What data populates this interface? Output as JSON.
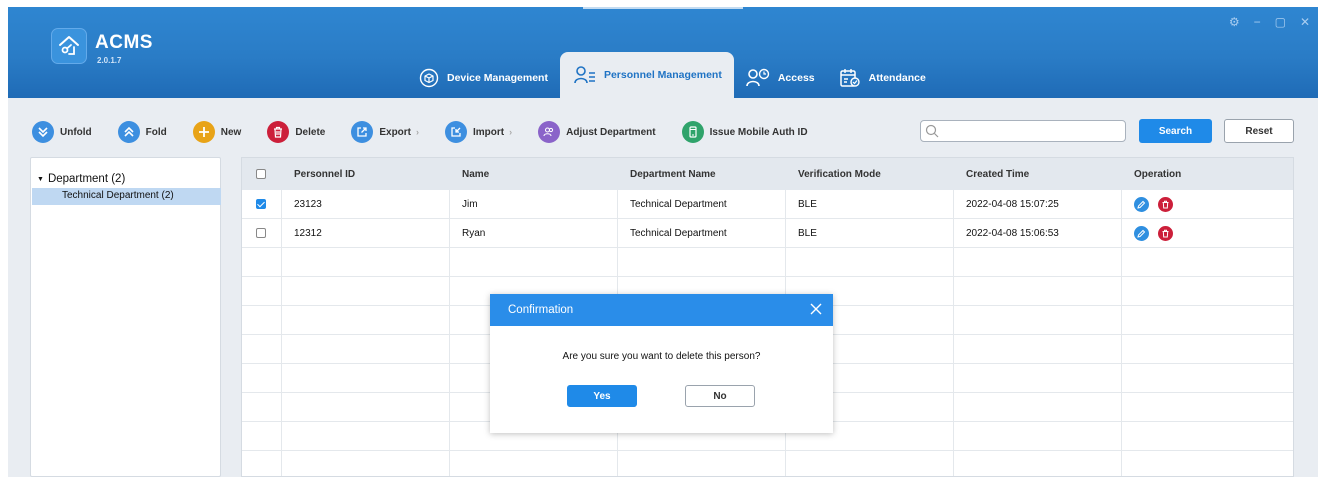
{
  "app": {
    "name": "ACMS",
    "version": "2.0.1.7",
    "colors": {
      "header": "#2a7cc6",
      "accent": "#1f8ae8",
      "danger": "#cc1f3a",
      "selection": "#bfd8f2"
    }
  },
  "window_controls": [
    "⚙",
    "−",
    "▢",
    "✕"
  ],
  "nav": {
    "tabs": [
      {
        "label": "Device Management",
        "icon": "device-box-icon",
        "active": false
      },
      {
        "label": "Personnel Management",
        "icon": "personnel-list-icon",
        "active": true
      },
      {
        "label": "Access",
        "icon": "access-person-clock-icon",
        "active": false
      },
      {
        "label": "Attendance",
        "icon": "calendar-check-icon",
        "active": false
      }
    ]
  },
  "toolbar": {
    "unfold": "Unfold",
    "fold": "Fold",
    "new": "New",
    "delete": "Delete",
    "export": "Export",
    "import": "Import",
    "adjust_department": "Adjust Department",
    "issue_mobile_auth": "Issue Mobile Auth ID"
  },
  "search": {
    "placeholder": "",
    "value": "",
    "search_label": "Search",
    "reset_label": "Reset"
  },
  "tree": {
    "root": "Department (2)",
    "children": [
      "Technical Department (2)"
    ]
  },
  "table": {
    "columns": [
      "Personnel ID",
      "Name",
      "Department Name",
      "Verification Mode",
      "Created Time",
      "Operation"
    ],
    "rows": [
      {
        "checked": true,
        "id": "23123",
        "name": "Jim",
        "department": "Technical Department",
        "mode": "BLE",
        "created": "2022-04-08 15:07:25"
      },
      {
        "checked": false,
        "id": "12312",
        "name": "Ryan",
        "department": "Technical Department",
        "mode": "BLE",
        "created": "2022-04-08 15:06:53"
      }
    ]
  },
  "dialog": {
    "title": "Confirmation",
    "message": "Are you sure you want to delete this person?",
    "yes": "Yes",
    "no": "No"
  }
}
